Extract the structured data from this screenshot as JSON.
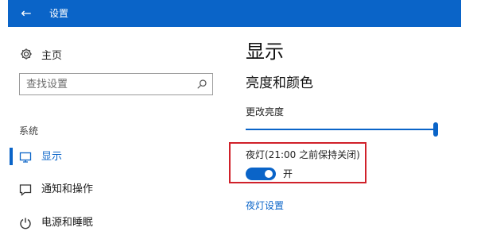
{
  "window": {
    "title": "设置",
    "accent_color": "#0a64c8",
    "highlight_color": "#d0212a"
  },
  "sidebar": {
    "home_label": "主页",
    "search": {
      "value": "",
      "placeholder": "查找设置"
    },
    "group_label": "系统",
    "items": [
      {
        "label": "显示",
        "icon": "monitor-icon",
        "active": true
      },
      {
        "label": "通知和操作",
        "icon": "message-icon",
        "active": false
      },
      {
        "label": "电源和睡眠",
        "icon": "power-icon",
        "active": false
      }
    ]
  },
  "main": {
    "page_title": "显示",
    "section_title": "亮度和颜色",
    "brightness": {
      "label": "更改亮度",
      "value": 1.0
    },
    "night_light": {
      "label": "夜灯(21:00 之前保持关闭)",
      "on": true,
      "state_label": "开"
    },
    "night_light_settings_link": "夜灯设置"
  }
}
